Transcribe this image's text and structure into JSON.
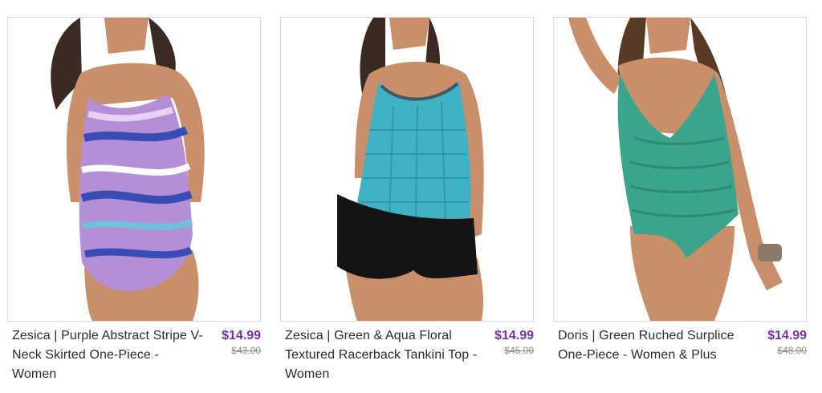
{
  "products": [
    {
      "title": "Zesica | Purple Abstract Stripe V-Neck Skirted One-Piece - Women",
      "price": "$14.99",
      "original_price": "$43.00",
      "image": "product-photo-purple-abstract-swimsuit",
      "swimsuit_color": "#b48fd6"
    },
    {
      "title": "Zesica | Green & Aqua Floral Textured Racerback Tankini Top - Women",
      "price": "$14.99",
      "original_price": "$45.00",
      "image": "product-photo-aqua-tankini",
      "swimsuit_color": "#3fb3c4"
    },
    {
      "title": "Doris | Green Ruched Surplice One-Piece - Women & Plus",
      "price": "$14.99",
      "original_price": "$48.00",
      "image": "product-photo-green-ruched-one-piece",
      "swimsuit_color": "#3aa58c"
    }
  ],
  "colors": {
    "sale_price": "#7b2fa6",
    "original_price": "#8a8a8a",
    "title_text": "#2c2c2c",
    "card_border": "#d9d9d9"
  }
}
